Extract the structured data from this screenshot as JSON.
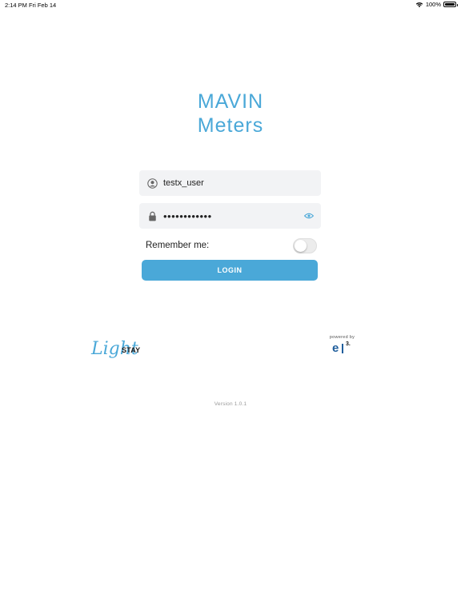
{
  "status_bar": {
    "time": "2:14 PM",
    "date": "Fri Feb 14",
    "battery": "100%",
    "wifi_icon": "wifi-icon",
    "battery_icon": "battery-icon"
  },
  "app": {
    "title_line1": "MAVIN",
    "title_line2": "Meters"
  },
  "login_form": {
    "username_value": "testx_user",
    "username_icon": "user-icon",
    "password_value": "••••••••••••",
    "password_icon": "lock-icon",
    "password_reveal_icon": "eye-icon",
    "remember_label": "Remember me:",
    "remember_on": false,
    "login_label": "LOGIN"
  },
  "footer": {
    "lightstay_light": "Light",
    "lightstay_stay": "STAY",
    "powered_by": "powered by",
    "e3_e": "e",
    "e3_3": "3.",
    "version": "Version 1.0.1"
  },
  "colors": {
    "accent": "#4aa8d8",
    "field_bg": "#f2f3f5",
    "e3_blue": "#1f5e9c"
  }
}
